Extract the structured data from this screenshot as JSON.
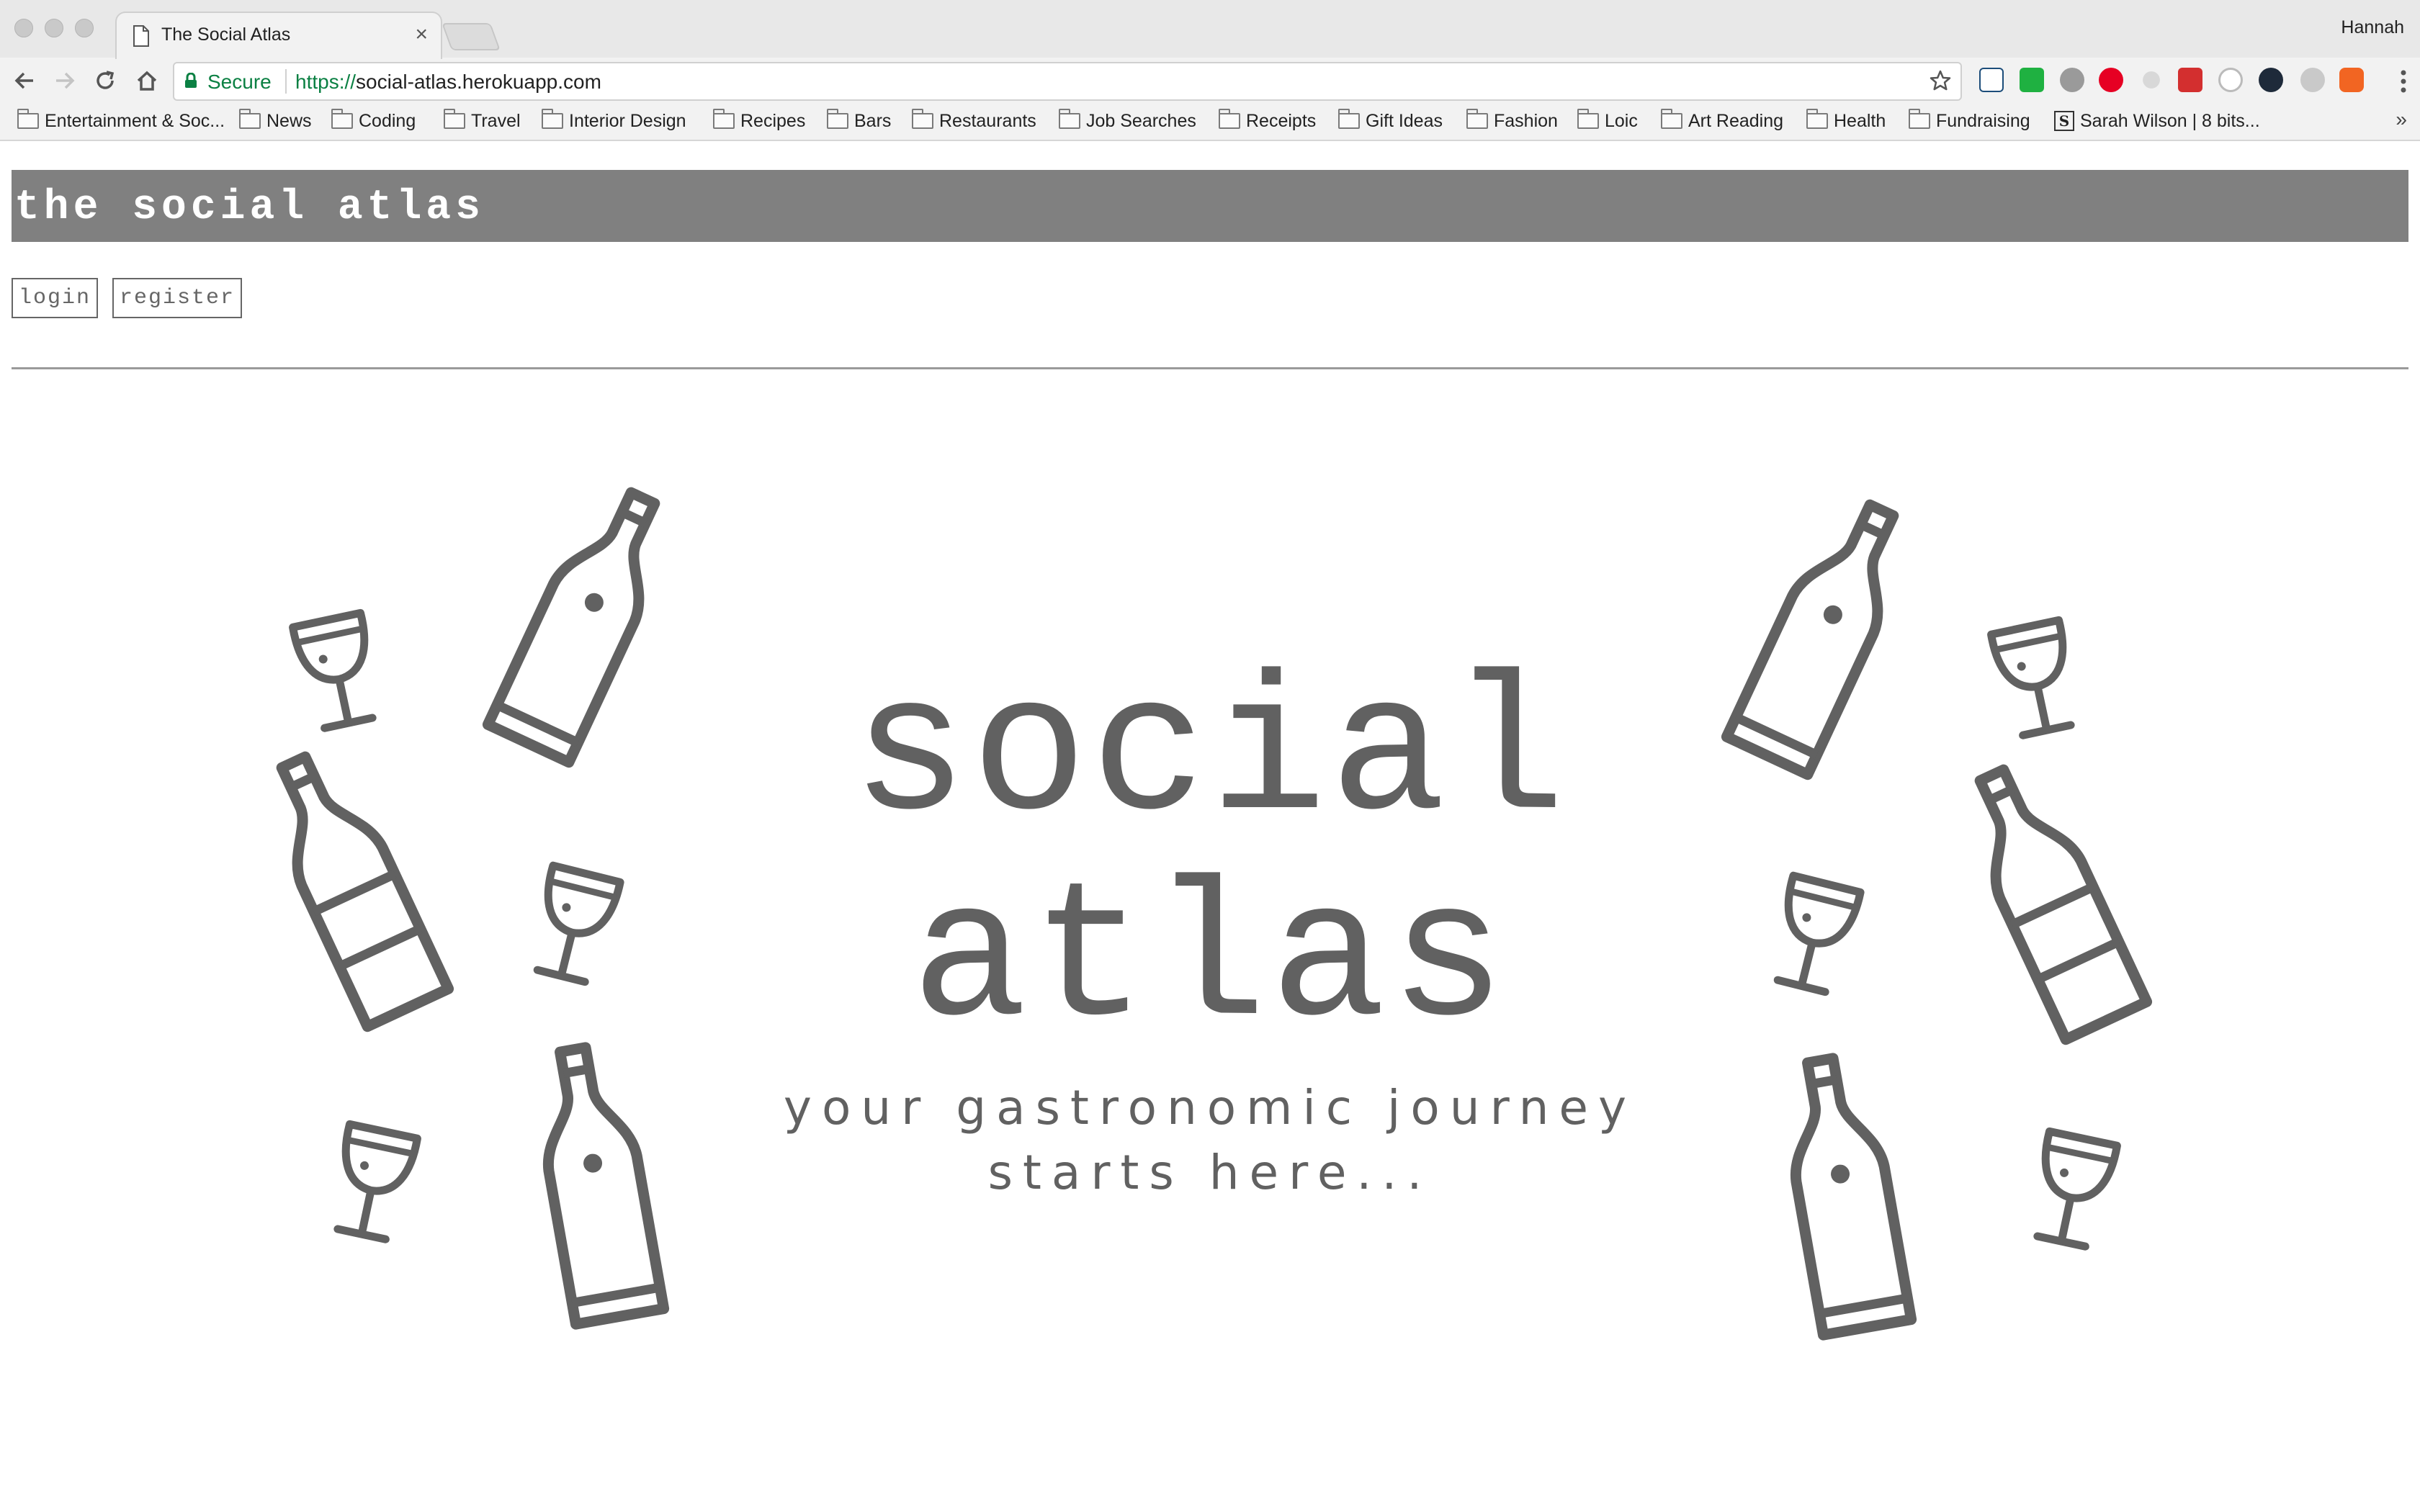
{
  "browser": {
    "tab_title": "The Social Atlas",
    "tab_close": "×",
    "user": "Hannah",
    "security_label": "Secure",
    "url_scheme": "https://",
    "url_rest": "social-atlas.herokuapp.com",
    "more_bookmarks": "»",
    "bookmarks": [
      {
        "label": "Entertainment & Soc...",
        "icon": "folder-icon"
      },
      {
        "label": "News",
        "icon": "folder-icon"
      },
      {
        "label": "Coding",
        "icon": "folder-icon"
      },
      {
        "label": "Travel",
        "icon": "folder-icon"
      },
      {
        "label": "Interior Design",
        "icon": "folder-icon"
      },
      {
        "label": "Recipes",
        "icon": "folder-icon"
      },
      {
        "label": "Bars",
        "icon": "folder-icon"
      },
      {
        "label": "Restaurants",
        "icon": "folder-icon"
      },
      {
        "label": "Job Searches",
        "icon": "folder-icon"
      },
      {
        "label": "Receipts",
        "icon": "folder-icon"
      },
      {
        "label": "Gift Ideas",
        "icon": "folder-icon"
      },
      {
        "label": "Fashion",
        "icon": "folder-icon"
      },
      {
        "label": "Loic",
        "icon": "folder-icon"
      },
      {
        "label": "Art Reading",
        "icon": "folder-icon"
      },
      {
        "label": "Health",
        "icon": "folder-icon"
      },
      {
        "label": "Fundraising",
        "icon": "folder-icon"
      },
      {
        "label": "Sarah Wilson | 8 bits...",
        "icon": "site-favicon-icon",
        "favicon_letter": "S"
      }
    ]
  },
  "site": {
    "title": "the social atlas",
    "header_color": "#808080",
    "login_label": "login",
    "register_label": "register"
  },
  "hero": {
    "title_line1": "social",
    "title_line2": "atlas",
    "tagline_line1": "your gastronomic journey",
    "tagline_line2": "starts here...",
    "illustration_color": "#616161",
    "illustrations": [
      "wine-bottle-icon",
      "wine-glass-icon"
    ]
  }
}
